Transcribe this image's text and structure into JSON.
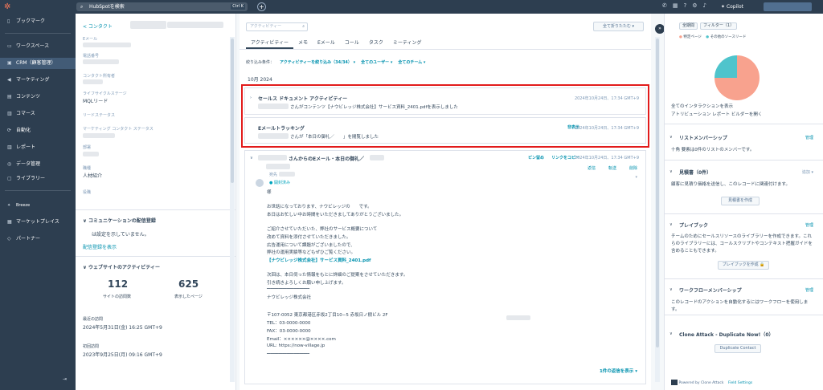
{
  "topbar": {
    "search_placeholder": "HubSpotを検索",
    "search_shortcut": "Ctrl K",
    "copilot_label": "Copilot"
  },
  "nav": {
    "items": [
      {
        "label": "ブックマーク",
        "icon": "bookmark-icon"
      },
      {
        "label": "ワークスペース",
        "icon": "workspace-icon"
      },
      {
        "label": "CRM（顧客管理）",
        "icon": "crm-icon"
      },
      {
        "label": "マーケティング",
        "icon": "megaphone-icon"
      },
      {
        "label": "コンテンツ",
        "icon": "content-icon"
      },
      {
        "label": "コマース",
        "icon": "commerce-icon"
      },
      {
        "label": "自動化",
        "icon": "automation-icon"
      },
      {
        "label": "レポート",
        "icon": "report-icon"
      },
      {
        "label": "データ管理",
        "icon": "data-icon"
      },
      {
        "label": "ライブラリー",
        "icon": "library-icon"
      },
      {
        "label": "Breeze",
        "icon": "breeze-icon"
      },
      {
        "label": "マーケットプレイス",
        "icon": "marketplace-icon"
      },
      {
        "label": "パートナー",
        "icon": "partner-icon"
      }
    ]
  },
  "contact": {
    "back_label": "< コンタクト",
    "actions_label": "⋯",
    "props": {
      "email_label": "Eメール",
      "phone_label": "電話番号",
      "owner_label": "コンタクト所有者",
      "lifecycle_label": "ライフサイクルステージ",
      "lifecycle_value": "MQLリード",
      "lead_status_label": "リードステータス",
      "mkt_status_label": "マーケティング コンタクト ステータス",
      "dept_label": "部署",
      "job_label": "職種",
      "job_value": "人材紹介",
      "position_label": "役職"
    },
    "subscription": {
      "title": "コミュニケーションの配信登録",
      "text": "は設定を示していません。",
      "link": "配信登録を表示"
    },
    "web_activity": {
      "title": "ウェブサイトのアクティビティー",
      "visits_value": "112",
      "visits_label": "サイトの訪問数",
      "pages_value": "625",
      "pages_label": "表示したページ",
      "last_visit_label": "最近の訪問",
      "last_visit_value": "2024年5月31日(金) 16:25 GMT+9",
      "first_visit_label": "初回訪問",
      "first_visit_value": "2023年9月25日(月) 09:16 GMT+9"
    }
  },
  "main": {
    "search_placeholder": "アクティビティー",
    "collapse_all": "全て折りたたむ ▾",
    "tabs": [
      "アクティビティー",
      "メモ",
      "Eメール",
      "コール",
      "タスク",
      "ミーティング"
    ],
    "filter_label": "絞り込み条件：",
    "filter_activity": "アクティビティーを絞り込み（34/34） ▾",
    "filter_users": "全てのユーザー ▾",
    "filter_teams": "全てのチーム ▾",
    "month": "10月 2024",
    "card1": {
      "title": "セールス ドキュメント アクティビティー",
      "date": "2024年10月24日、17:34 GMT+9",
      "body": "さんがコンテンツ【ナウビレッジ株式会社】サービス資料_2401.pdfを表示しました"
    },
    "card2": {
      "title": "Eメールトラッキング",
      "hide": "非表示",
      "date": "2024年10月24日、17:34 GMT+9",
      "body": "さんが「本日の御礼／　　」を閲覧しました"
    },
    "email": {
      "title": "さんからのEメール・本日の御礼／",
      "pin": "ピン留め",
      "copy_link": "リンクをコピー",
      "date": "2024年10月24日、17:34 GMT+9",
      "to_label": "宛先",
      "opened": "開封済み",
      "reply": "返信",
      "forward": "転送",
      "delete": "削除",
      "lines": [
        "様",
        "",
        "お世話になっております、ナウビレッジの　　です。",
        "本日はお忙しい中お時間をいただきましてありがとうございました。",
        "",
        "ご紹介させていただいた、弊社のサービス概要について",
        "改めて資料を添付させていただきました。",
        "広告運用について課題がございましたので、",
        "弊社の運用実績等などもぜひご覧ください。",
        "【ナウビレッジ株式会社】サービス資料_2401.pdf",
        "",
        "次回は、本日伺った情報をもとに詳細のご提案をさせていただきます。",
        "引き続きよろしくお願い申し上げます。",
        "━━━━━━━━━━━━━━━━━━━━━━",
        "ナウビレッジ株式会社",
        "",
        "〒107-0052 東京都港区赤坂2丁目10−5 赤坂日ノ樹ビル 2F",
        "TEL：03-0000-0000",
        "FAX：03-0000-0000",
        "Email：××××××@××××.com",
        "URL: https://now-village.jp",
        "━━━━━━━━━━━━━━━━━━━━━━"
      ],
      "thread_link": "1件の返信を表示 ▾"
    }
  },
  "right": {
    "pill1": "全期間",
    "pill2": "フィルター（1）",
    "legend1": "特定ページ",
    "legend2": "その他のソースリード",
    "chart_data": {
      "type": "pie",
      "values": [
        75,
        25
      ],
      "colors": [
        "#f8a28e",
        "#4fc4cc"
      ]
    },
    "link1": "全てのインタラクションを表示",
    "link2": "アトリビューション レポート ビルダーを開く",
    "list_title": "リストメンバーシップ",
    "list_manage": "管理",
    "list_text": "十角 要素は0件のリストのメンバーです。",
    "quote_title": "見積書（0件）",
    "quote_add": "追加 ▾",
    "quote_text": "顧客に見積り価格を送信し、このレコードに関連付けます。",
    "quote_btn": "見積書を作成",
    "playbook_title": "プレイブック",
    "playbook_manage": "管理",
    "playbook_text": "チームのためにセールスリソースのライブラリーを作成できます。これらのライブラリーには、コールスクリプトやコンテキスト把握ガイドを含めることもできます。",
    "playbook_btn": "プレイブックを作成 🔒",
    "workflow_title": "ワークフローメンバーシップ",
    "workflow_manage": "管理",
    "workflow_text": "このレコードのアクションを自動化するにはワークフローを使用します。",
    "clone_title": "Clone Attack - Duplicate Now!（0）",
    "clone_btn": "Duplicate Contact",
    "powered": "Powered by Clone Attack",
    "field_settings": "Field Settings"
  }
}
